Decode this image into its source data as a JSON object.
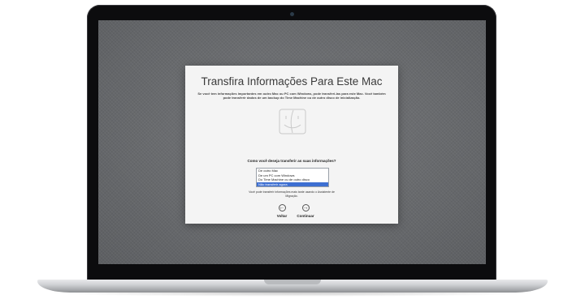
{
  "dialog": {
    "title": "Transfira Informações Para Este Mac",
    "subtitle": "Se você tem informações importantes em outro Mac ou PC com Windows, pode transferi-las para este Mac. Você também pode transferir dados de um backup do Time Machine ou de outro disco de inicialização.",
    "question": "Como você deseja transferir as suas informações?",
    "options": [
      "De outro Mac",
      "De um PC com Windows",
      "Do Time Machine ou de outro disco",
      "Não transferir agora"
    ],
    "selected_option": "Não transferir agora",
    "note": "Você pode transferir informações mais tarde usando o Assistente de Migração.",
    "back_label": "Voltar",
    "continue_label": "Continuar"
  },
  "icons": {
    "finder": "finder-icon",
    "back": "left-arrow-icon",
    "continue": "right-arrow-icon"
  },
  "colors": {
    "selection": "#3d6fd2",
    "screen": "#6b6d70",
    "dialog": "#f4f4f4"
  }
}
